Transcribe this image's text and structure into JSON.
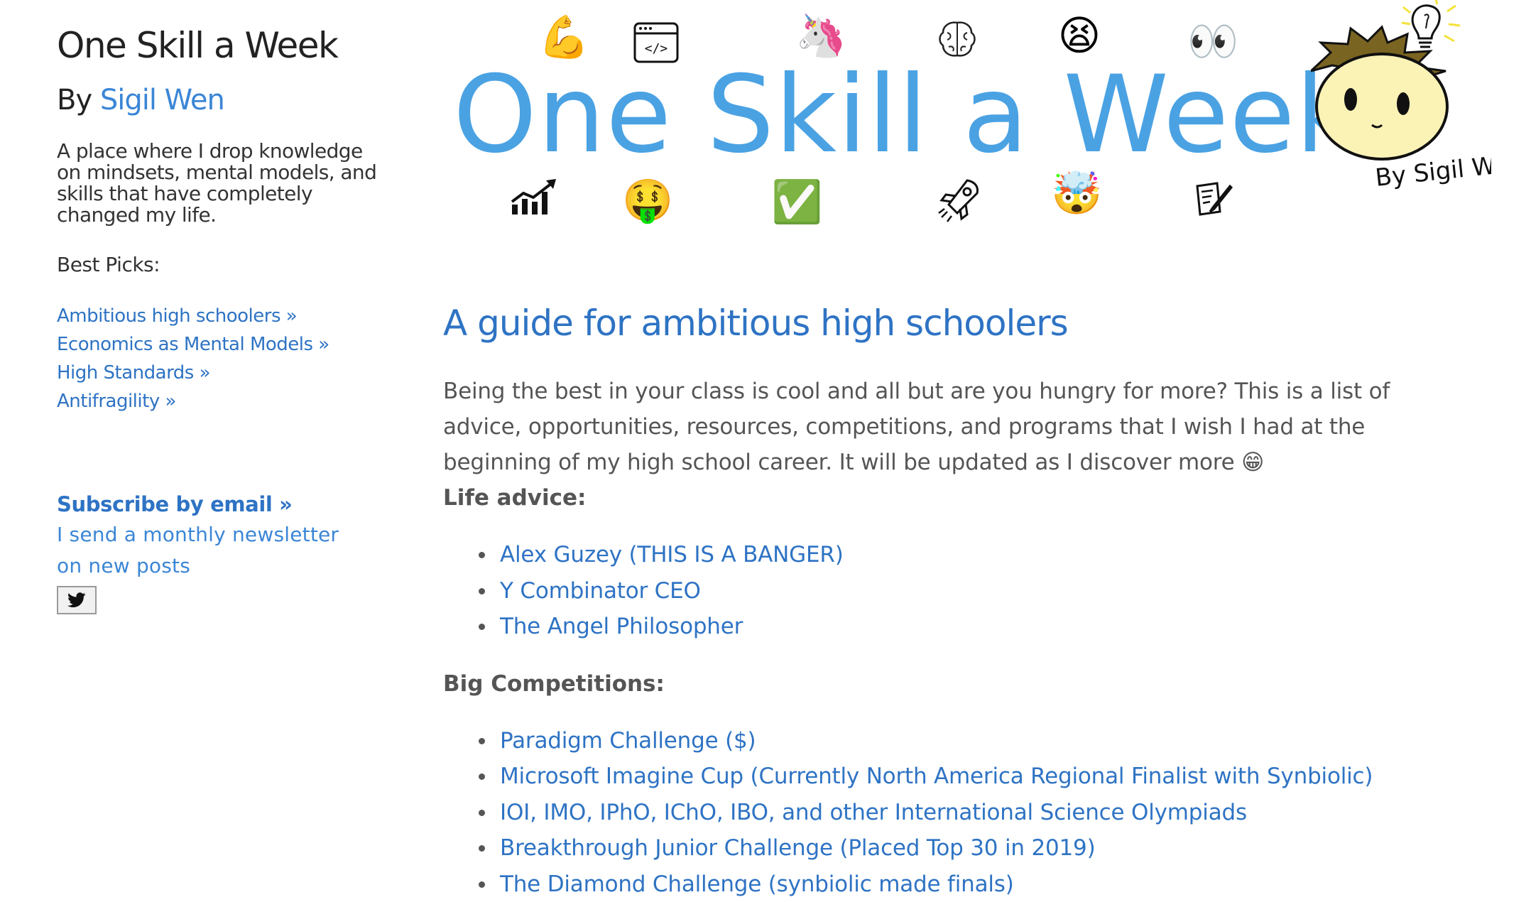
{
  "sidebar": {
    "site_title": "One Skill a Week",
    "by_prefix": "By",
    "author_name": "Sigil Wen",
    "tagline": "A place where I drop knowledge on mindsets, mental models, and skills that have completely changed my life.",
    "best_picks_label": "Best Picks:",
    "best_picks": [
      {
        "label": "Ambitious high schoolers »"
      },
      {
        "label": "Economics as Mental Models »"
      },
      {
        "label": "High Standards »"
      },
      {
        "label": "Antifragility »"
      }
    ],
    "subscribe_label": "Subscribe by email »",
    "newsletter_note": "I send a monthly newsletter on new posts",
    "twitter_icon": "twitter-bird-icon"
  },
  "banner": {
    "title": "One Skill a Week",
    "signature": "By Sigil Wen",
    "emojis_top": [
      "💪",
      "💻",
      "🦄",
      "🧠",
      "😫",
      "👀"
    ],
    "emojis_bottom": [
      "📈",
      "🤑",
      "✅",
      "🚀",
      "🤯",
      "📝"
    ]
  },
  "article": {
    "title": "A guide for ambitious high schoolers",
    "intro": "Being the best in your class is cool and all but are you hungry for more? This is a list of advice, opportunities, resources, competitions, and programs that I wish I had at the beginning of my high school career. It will be updated as I discover more 😁",
    "life_advice_heading": "Life advice:",
    "life_advice": [
      {
        "label": "Alex Guzey (THIS IS A BANGER)"
      },
      {
        "label": "Y Combinator CEO"
      },
      {
        "label": "The Angel Philosopher"
      }
    ],
    "competitions_heading": "Big Competitions:",
    "competitions": [
      {
        "label": "Paradigm Challenge ($)"
      },
      {
        "label": "Microsoft Imagine Cup (Currently North America Regional Finalist with Synbiolic)"
      },
      {
        "label": "IOI, IMO, IPhO, IChO, IBO, and other International Science Olympiads"
      },
      {
        "label": "Breakthrough Junior Challenge (Placed Top 30 in 2019)"
      },
      {
        "label": "The Diamond Challenge (synbiolic made finals)"
      }
    ]
  },
  "colors": {
    "link": "#2e73c4",
    "banner_title": "#4aa2e3",
    "text": "#555555",
    "heading": "#222222"
  }
}
